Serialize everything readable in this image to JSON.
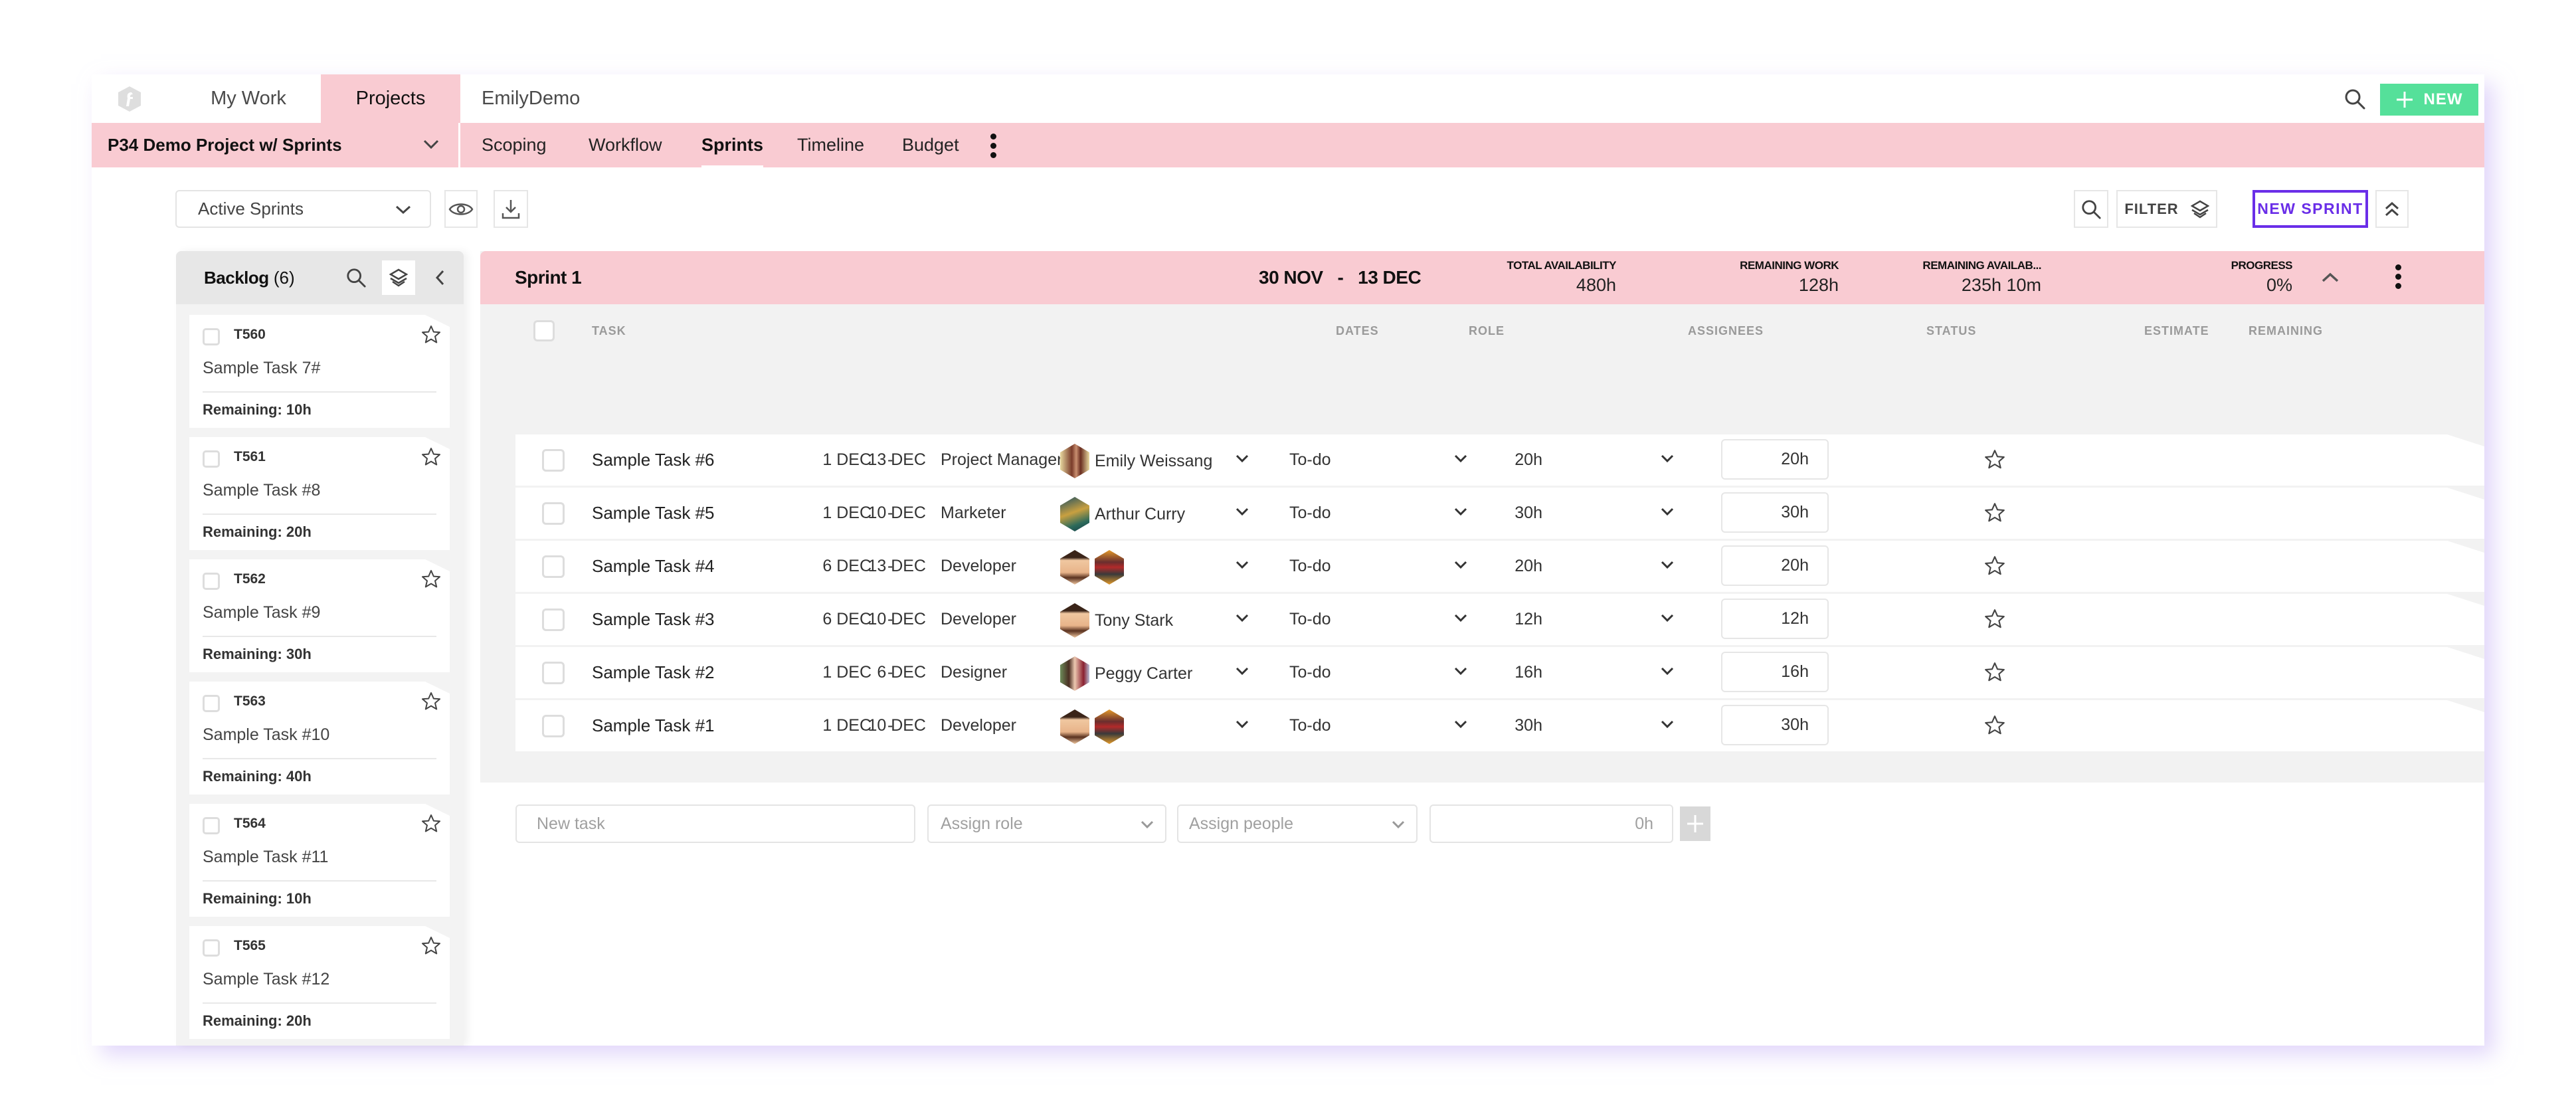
{
  "topnav": {
    "logo": "app-logo-icon",
    "tabs": [
      {
        "label": "My Work",
        "active": false
      },
      {
        "label": "Projects",
        "active": true
      },
      {
        "label": "EmilyDemo",
        "active": false
      }
    ],
    "new_button": "NEW"
  },
  "subnav": {
    "project_name": "P34 Demo Project w/ Sprints",
    "tabs": [
      {
        "label": "Scoping",
        "active": false
      },
      {
        "label": "Workflow",
        "active": false
      },
      {
        "label": "Sprints",
        "active": true
      },
      {
        "label": "Timeline",
        "active": false
      },
      {
        "label": "Budget",
        "active": false
      }
    ]
  },
  "toolbar": {
    "sprint_filter_value": "Active Sprints",
    "filter_label": "FILTER",
    "new_sprint_label": "NEW SPRINT"
  },
  "backlog": {
    "title": "Backlog",
    "count": "(6)",
    "items": [
      {
        "id": "T560",
        "name": "Sample Task 7#",
        "remaining": "Remaining: 10h"
      },
      {
        "id": "T561",
        "name": "Sample Task #8",
        "remaining": "Remaining: 20h"
      },
      {
        "id": "T562",
        "name": "Sample Task #9",
        "remaining": "Remaining: 30h"
      },
      {
        "id": "T563",
        "name": "Sample Task #10",
        "remaining": "Remaining: 40h"
      },
      {
        "id": "T564",
        "name": "Sample Task #11",
        "remaining": "Remaining: 10h"
      },
      {
        "id": "T565",
        "name": "Sample Task #12",
        "remaining": "Remaining: 20h"
      }
    ]
  },
  "sprint": {
    "name": "Sprint 1",
    "start": "30 NOV",
    "end": "13 DEC",
    "dash": "-",
    "stats": [
      {
        "label": "TOTAL AVAILABILITY",
        "value": "480h"
      },
      {
        "label": "REMAINING WORK",
        "value": "128h"
      },
      {
        "label": "REMAINING AVAILAB...",
        "value": "235h 10m"
      },
      {
        "label": "PROGRESS",
        "value": "0%"
      }
    ],
    "columns": {
      "task": "TASK",
      "dates": "DATES",
      "role": "ROLE",
      "assignees": "ASSIGNEES",
      "status": "STATUS",
      "estimate": "ESTIMATE",
      "remaining": "REMAINING"
    },
    "tasks": [
      {
        "name": "Sample Task #6",
        "start": "1 DEC",
        "end": "13 DEC",
        "role": "Project Manager",
        "assignee": "Emily Weissang",
        "avatars": [
          "emily"
        ],
        "status": "To-do",
        "estimate": "20h",
        "remaining": "20h"
      },
      {
        "name": "Sample Task #5",
        "start": "1 DEC",
        "end": "10 DEC",
        "role": "Marketer",
        "assignee": "Arthur Curry",
        "avatars": [
          "arthur"
        ],
        "status": "To-do",
        "estimate": "30h",
        "remaining": "30h"
      },
      {
        "name": "Sample Task #4",
        "start": "6 DEC",
        "end": "13 DEC",
        "role": "Developer",
        "assignee": "",
        "avatars": [
          "tony",
          "antman"
        ],
        "status": "To-do",
        "estimate": "20h",
        "remaining": "20h"
      },
      {
        "name": "Sample Task #3",
        "start": "6 DEC",
        "end": "10 DEC",
        "role": "Developer",
        "assignee": "Tony Stark",
        "avatars": [
          "tony"
        ],
        "status": "To-do",
        "estimate": "12h",
        "remaining": "12h"
      },
      {
        "name": "Sample Task #2",
        "start": "1 DEC",
        "end": "6 DEC",
        "role": "Designer",
        "assignee": "Peggy Carter",
        "avatars": [
          "peggy"
        ],
        "status": "To-do",
        "estimate": "16h",
        "remaining": "16h"
      },
      {
        "name": "Sample Task #1",
        "start": "1 DEC",
        "end": "10 DEC",
        "role": "Developer",
        "assignee": "",
        "avatars": [
          "tony",
          "antman"
        ],
        "status": "To-do",
        "estimate": "30h",
        "remaining": "30h"
      }
    ],
    "new_task": {
      "task_placeholder": "New task",
      "role_placeholder": "Assign role",
      "people_placeholder": "Assign people",
      "hours_placeholder": "0h"
    }
  },
  "colors": {
    "accent_pink": "#f9cbd2",
    "new_button_green": "#55e09a",
    "new_sprint_purple": "#6a2ee8"
  }
}
